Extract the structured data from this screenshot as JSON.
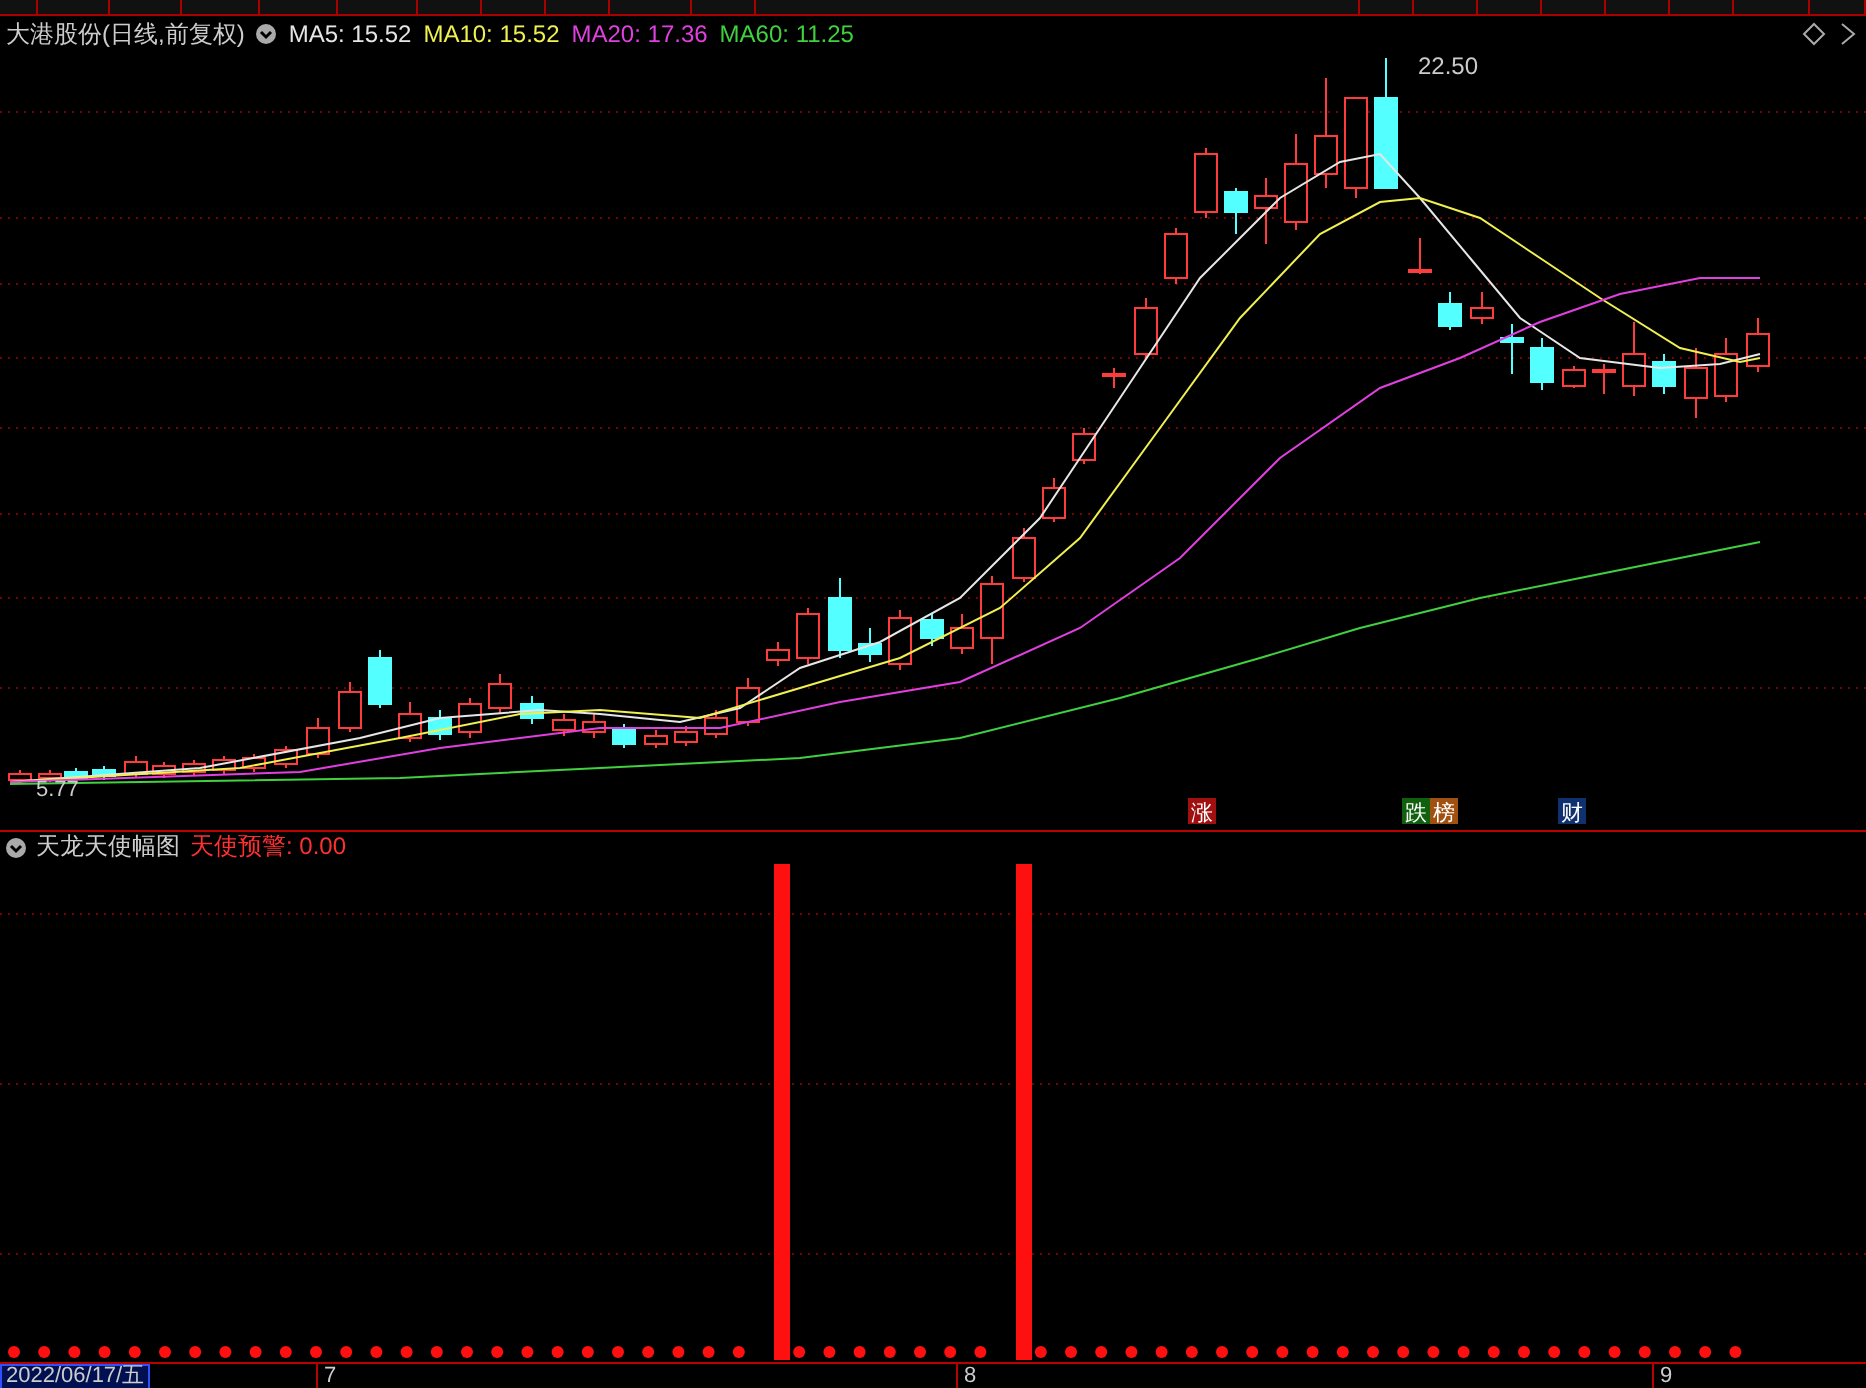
{
  "chart_header": {
    "title": "大港股份(日线,前复权)",
    "moving_averages": [
      {
        "label": "MA5: 15.52",
        "color": "#e6e6e6"
      },
      {
        "label": "MA10: 15.52",
        "color": "#f0f050"
      },
      {
        "label": "MA20: 17.36",
        "color": "#e040e0"
      },
      {
        "label": "MA60: 11.25",
        "color": "#40d040"
      }
    ]
  },
  "price_chart": {
    "high_label": "22.50",
    "low_label": "5.77",
    "markers": [
      {
        "label": "涨",
        "color": "#a01010"
      },
      {
        "label": "跌",
        "color": "#106010"
      },
      {
        "label": "榜",
        "color": "#a05010"
      },
      {
        "label": "财",
        "color": "#103070"
      }
    ]
  },
  "indicator": {
    "title": "天龙天使幅图",
    "reading": "天使预警: 0.00"
  },
  "date_axis": {
    "current_date": "2022/06/17/五",
    "ticks": [
      "7",
      "8",
      "9"
    ]
  }
}
